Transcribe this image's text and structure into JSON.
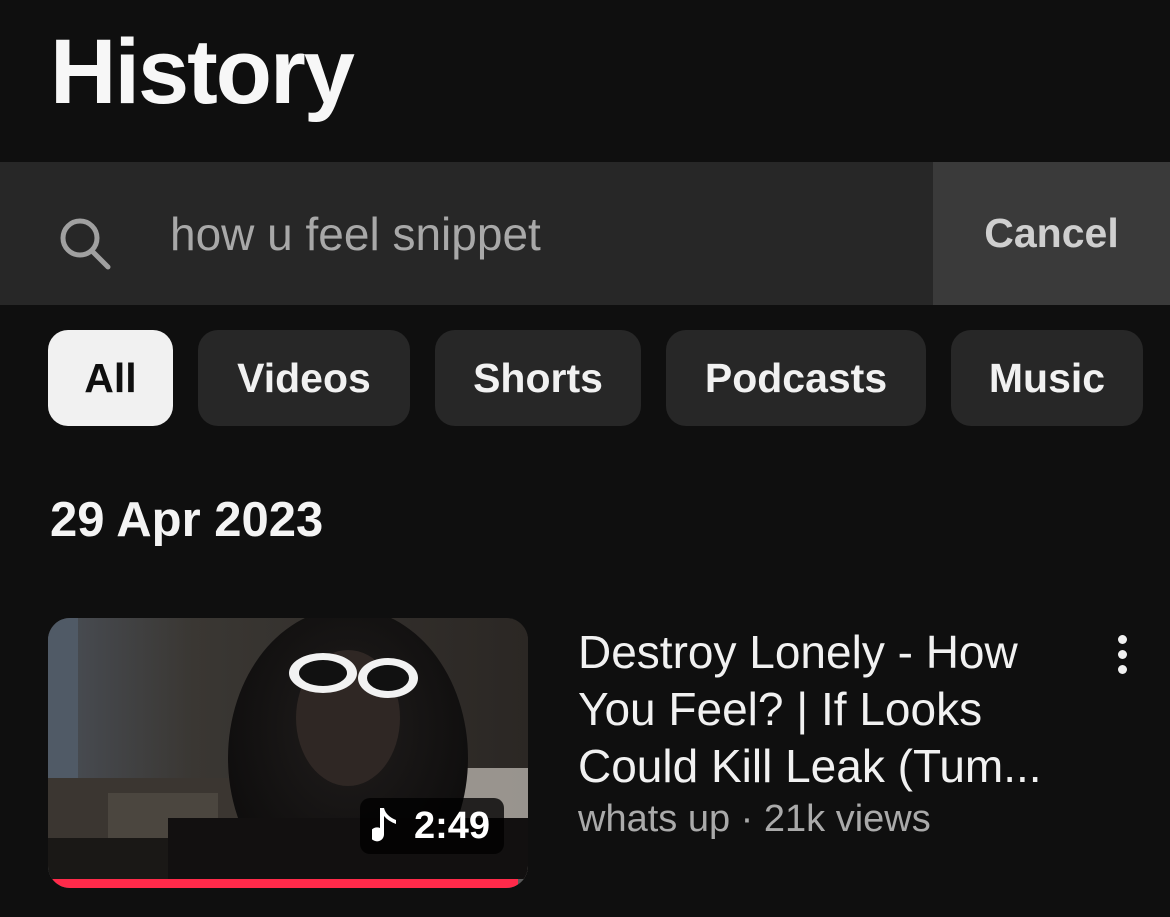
{
  "header": {
    "title": "History"
  },
  "search": {
    "value": "how u feel snippet",
    "icon": "search-icon",
    "cancel_label": "Cancel"
  },
  "filters": {
    "chips": [
      {
        "label": "All",
        "selected": true
      },
      {
        "label": "Videos",
        "selected": false
      },
      {
        "label": "Shorts",
        "selected": false
      },
      {
        "label": "Podcasts",
        "selected": false
      },
      {
        "label": "Music",
        "selected": false
      }
    ]
  },
  "history": {
    "groups": [
      {
        "date": "29 Apr 2023",
        "items": [
          {
            "title": "Destroy Lonely - How You Feel? | If Looks Could Kill Leak (Tum...",
            "meta": "whats up · 21k views",
            "duration": "2:49",
            "duration_icon": "music-note-icon",
            "watched_fraction": 0.98
          }
        ]
      }
    ]
  },
  "colors": {
    "background": "#0f0f0f",
    "surface": "#272727",
    "progress": "#ff2a4a",
    "chip_selected_bg": "#f1f1f1"
  }
}
